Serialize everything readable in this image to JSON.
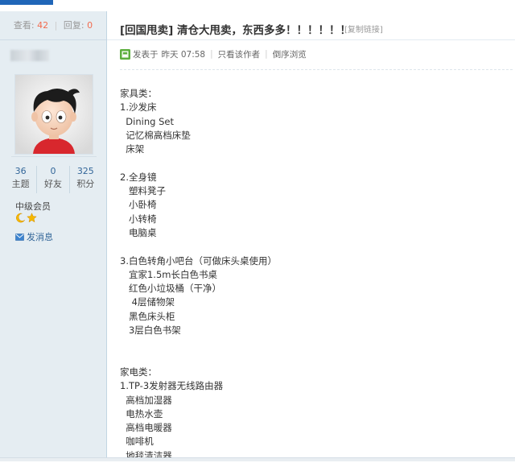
{
  "stats": {
    "views_label": "查看:",
    "views": "42",
    "replies_label": "回复:",
    "replies": "0"
  },
  "post": {
    "title": "[回国甩卖] 清仓大甩卖，东西多多！！！！！！",
    "copy_link": "[复制链接]",
    "posted_label": "发表于",
    "posted_time": "昨天 07:58",
    "only_author": "只看该作者",
    "reverse_browse": "倒序浏览",
    "content_lines": [
      "家具类：",
      "1.沙发床",
      "  Dining Set",
      "  记忆棉高档床垫",
      "  床架",
      "",
      "2.全身镜",
      "   塑料凳子",
      "   小卧椅",
      "   小转椅",
      "   电脑桌",
      "",
      "3.白色转角小吧台（可做床头桌使用）",
      "   宜家1.5m长白色书桌",
      "   红色小垃圾桶（干净）",
      "    4层储物架",
      "   黑色床头柜",
      "   3层白色书架",
      "",
      "",
      "家电类：",
      "1.TP-3发射器无线路由器",
      "  高档加湿器",
      "  电热水壶",
      "  高档电暖器",
      "  咖啡机",
      "  地毯清洁器"
    ]
  },
  "profile": {
    "counts": [
      {
        "num": "36",
        "label": "主题"
      },
      {
        "num": "0",
        "label": "好友"
      },
      {
        "num": "325",
        "label": "积分"
      }
    ],
    "rank": "中级会员",
    "send_message": "发消息"
  },
  "colors": {
    "accent": "#2066b8",
    "highlight": "#f26c4f",
    "link": "#336699",
    "sidebar_bg": "#e5edf2"
  },
  "icons": {
    "author": "author-icon",
    "moon": "moon-icon",
    "star": "star-icon",
    "envelope": "envelope-icon"
  }
}
